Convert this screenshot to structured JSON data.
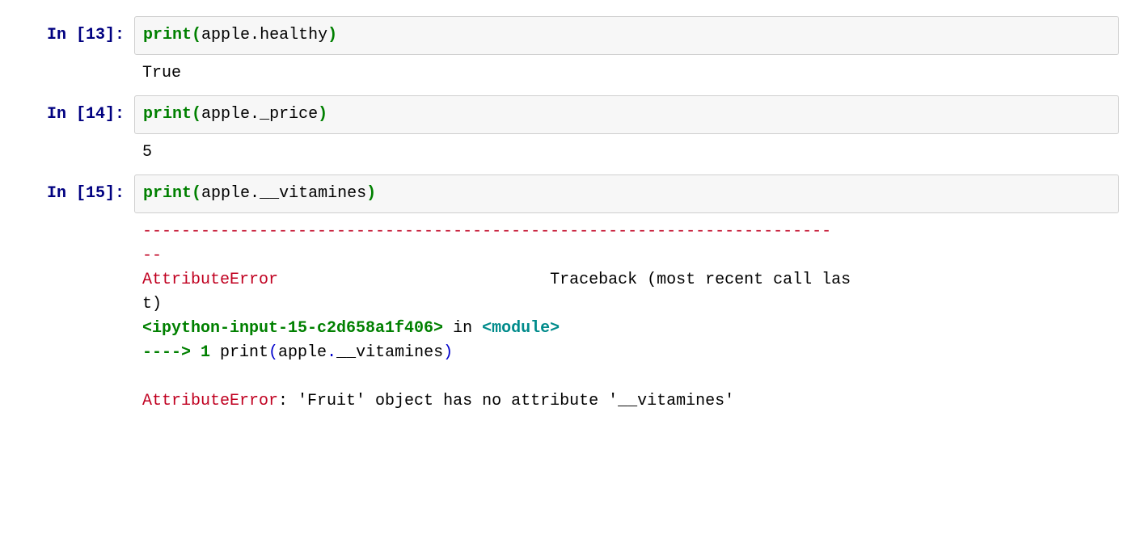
{
  "cells": [
    {
      "prompt": {
        "label": "In ",
        "num": "13"
      },
      "code": {
        "fn": "print",
        "arg": "apple",
        "attr": "healthy"
      },
      "output_plain": "True"
    },
    {
      "prompt": {
        "label": "In ",
        "num": "14"
      },
      "code": {
        "fn": "print",
        "arg": "apple",
        "attr": "_price"
      },
      "output_plain": "5"
    },
    {
      "prompt": {
        "label": "In ",
        "num": "15"
      },
      "code": {
        "fn": "print",
        "arg": "apple",
        "attr": "__vitamines"
      },
      "traceback": {
        "dashes": "-----------------------------------------------------------------------",
        "dashes2": "--",
        "errtype": "AttributeError",
        "tb_label": "Traceback (most recent call las",
        "tb_label2": "t)",
        "frame_loc": "<ipython-input-15-c2d658a1f406>",
        "in_word": " in ",
        "module": "<module>",
        "arrow": "----> 1 ",
        "call_fn": "print",
        "call_lp": "(",
        "call_obj": "apple",
        "call_dot": ".",
        "call_attr": "__vitamines",
        "call_rp": ")",
        "final_err": "AttributeError",
        "final_msg": ": 'Fruit' object has no attribute '__vitamines'"
      }
    }
  ]
}
